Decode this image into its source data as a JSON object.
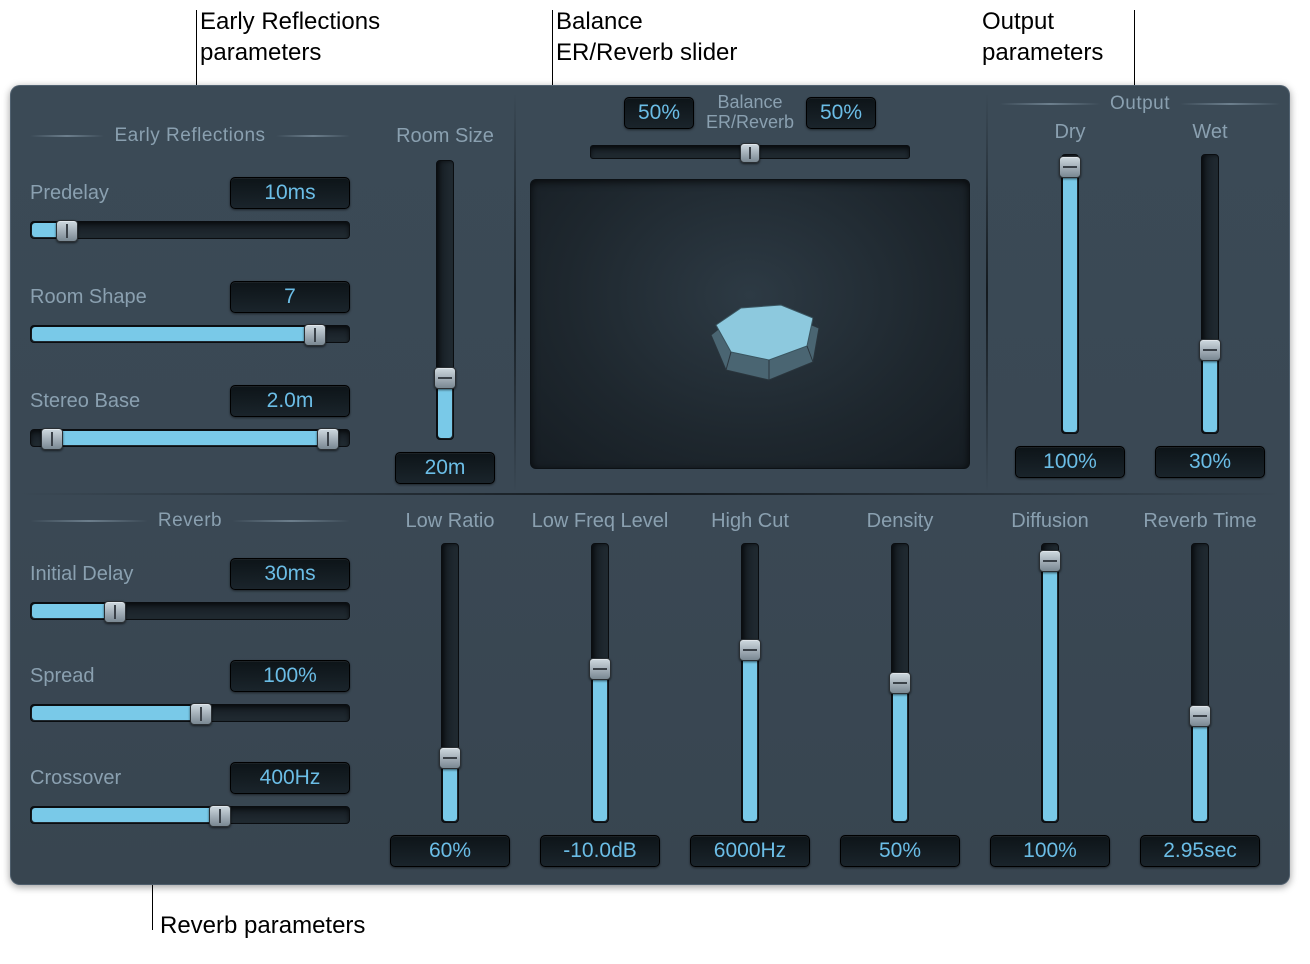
{
  "callouts": {
    "early_reflections": "Early Reflections\nparameters",
    "balance": "Balance\nER/Reverb slider",
    "output": "Output\nparameters",
    "reverb": "Reverb parameters"
  },
  "early_reflections": {
    "title": "Early Reflections",
    "predelay": {
      "label": "Predelay",
      "value": "10ms",
      "pct": 8
    },
    "room_shape": {
      "label": "Room Shape",
      "value": "7",
      "pct": 88
    },
    "stereo_base": {
      "label": "Stereo Base",
      "value": "2.0m",
      "left_pct": 5,
      "right_pct": 92
    }
  },
  "room_size": {
    "label": "Room Size",
    "value": "20m",
    "pct": 20
  },
  "balance": {
    "label_top": "Balance",
    "label_bottom": "ER/Reverb",
    "left": "50%",
    "right": "50%",
    "pos_pct": 50
  },
  "output": {
    "title": "Output",
    "dry": {
      "label": "Dry",
      "value": "100%",
      "pct": 100
    },
    "wet": {
      "label": "Wet",
      "value": "30%",
      "pct": 30
    }
  },
  "reverb": {
    "title": "Reverb",
    "initial_delay": {
      "label": "Initial Delay",
      "value": "30ms",
      "pct": 25
    },
    "spread": {
      "label": "Spread",
      "value": "100%",
      "pct": 52
    },
    "crossover": {
      "label": "Crossover",
      "value": "400Hz",
      "pct": 58
    }
  },
  "bottom_params": {
    "low_ratio": {
      "label": "Low Ratio",
      "value": "60%",
      "pct": 23
    },
    "low_freq": {
      "label": "Low Freq Level",
      "value": "-10.0dB",
      "pct": 55
    },
    "high_cut": {
      "label": "High Cut",
      "value": "6000Hz",
      "pct": 62
    },
    "density": {
      "label": "Density",
      "value": "50%",
      "pct": 50
    },
    "diffusion": {
      "label": "Diffusion",
      "value": "100%",
      "pct": 97
    },
    "reverb_time": {
      "label": "Reverb Time",
      "value": "2.95sec",
      "pct": 38
    }
  }
}
